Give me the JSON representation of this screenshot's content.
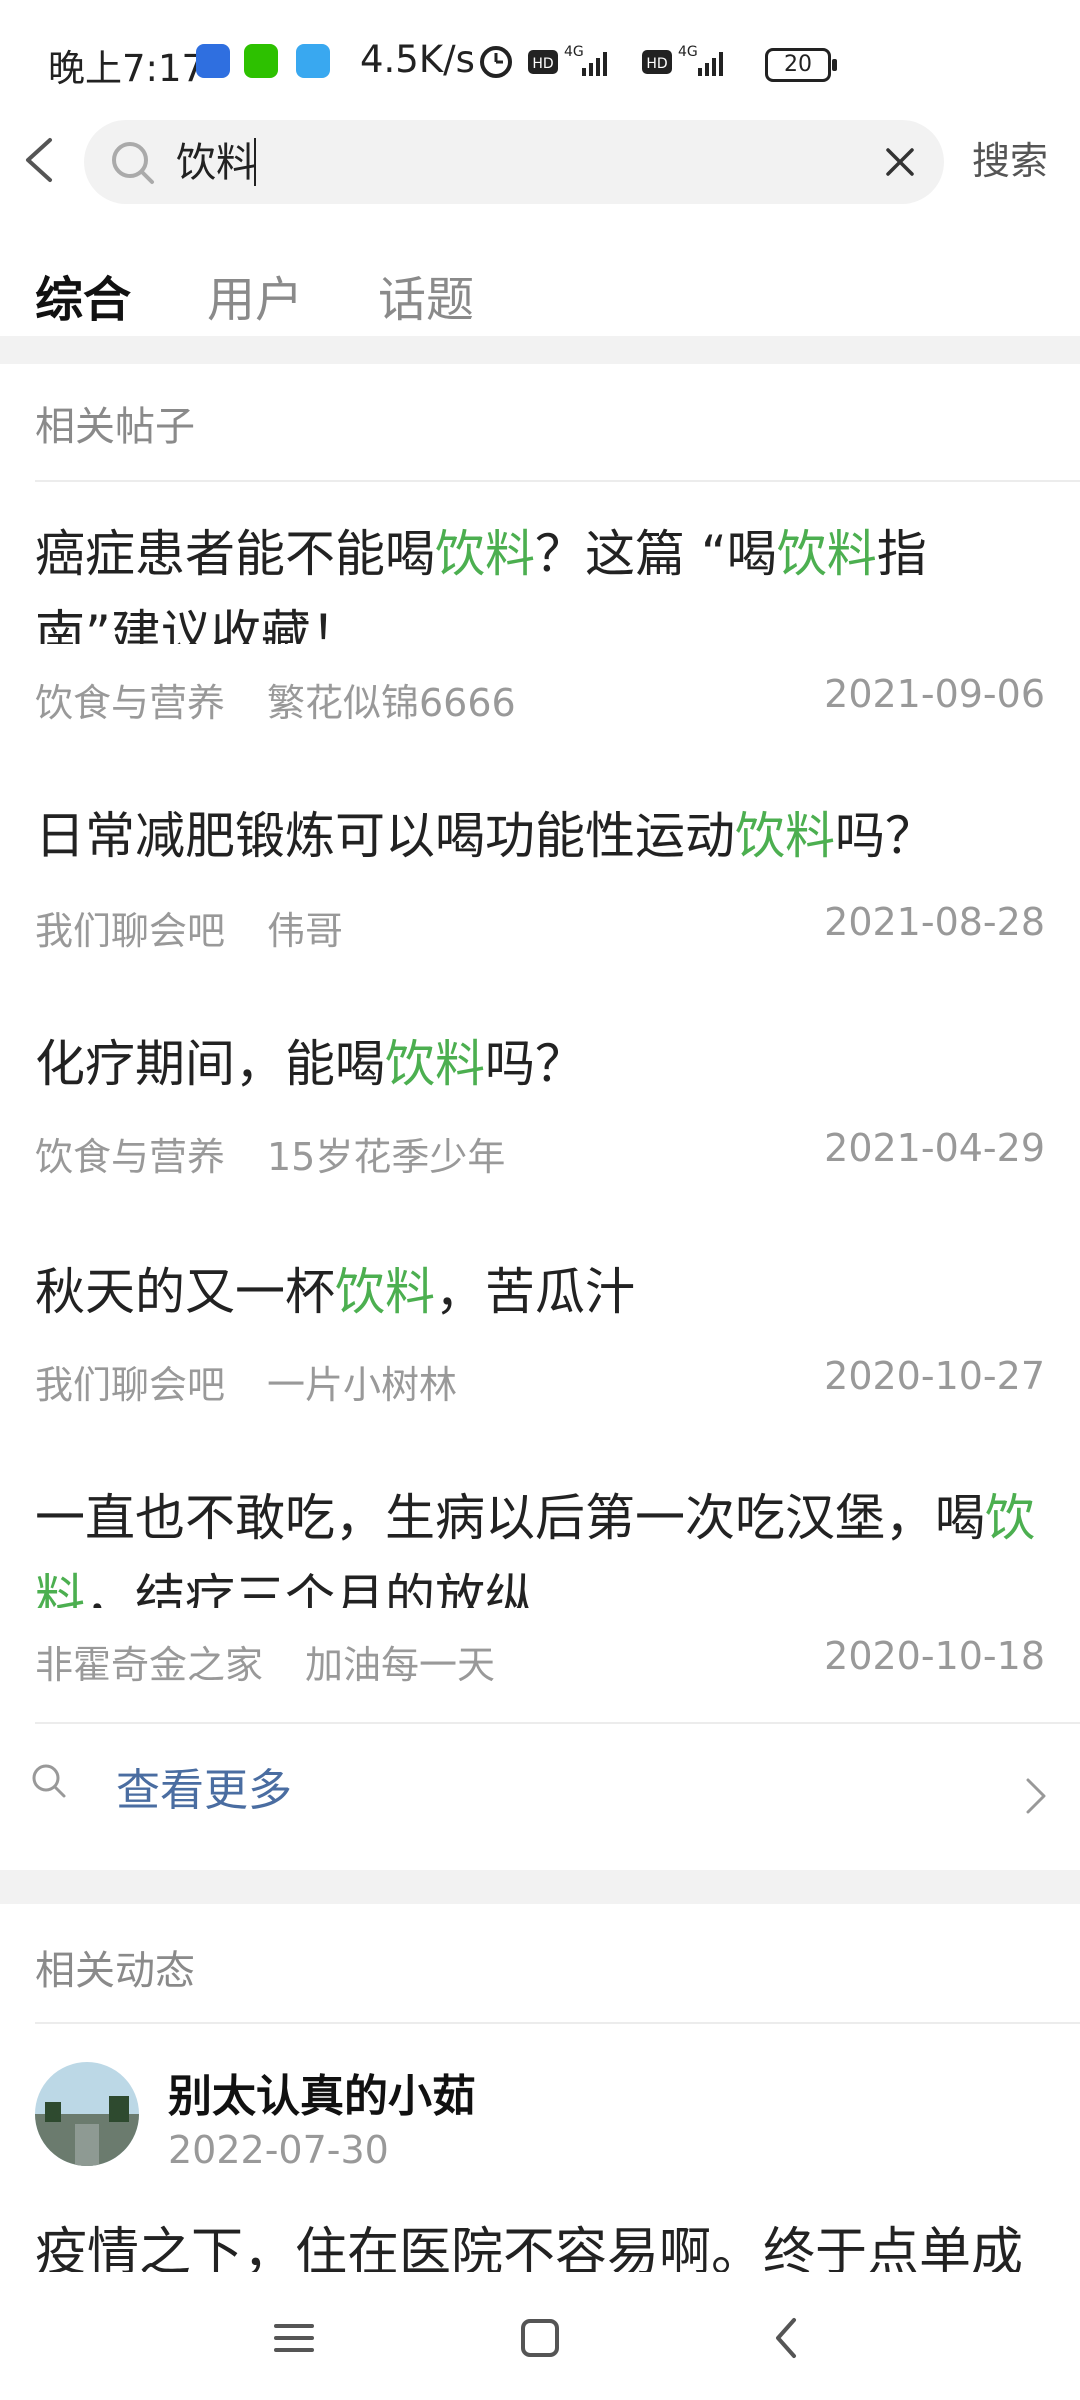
{
  "status": {
    "time": "晚上7:17",
    "net_speed": "4.5K/s",
    "battery": "20",
    "signal_1_label": "4G",
    "signal_2_label": "4G",
    "hd_1": "HD",
    "hd_2": "HD"
  },
  "search": {
    "query": "饮料",
    "submit_label": "搜索"
  },
  "tabs": [
    {
      "label": "综合",
      "active": true
    },
    {
      "label": "用户",
      "active": false
    },
    {
      "label": "话题",
      "active": false
    }
  ],
  "related_posts": {
    "section_title": "相关帖子",
    "posts": [
      {
        "title_parts": [
          "癌症患者能不能喝",
          "饮料",
          "？这篇 “喝",
          "饮料",
          "指南”建议收藏！"
        ],
        "forum": "饮食与营养",
        "author": "繁花似锦6666",
        "date": "2021-09-06"
      },
      {
        "title_parts": [
          "日常减肥锻炼可以喝功能性运动",
          "饮料",
          "吗？"
        ],
        "forum": "我们聊会吧",
        "author": "伟哥",
        "date": "2021-08-28"
      },
      {
        "title_parts": [
          "化疗期间，能喝",
          "饮料",
          "吗？"
        ],
        "forum": "饮食与营养",
        "author": "15岁花季少年",
        "date": "2021-04-29"
      },
      {
        "title_parts": [
          "秋天的又一杯",
          "饮料",
          "，苦瓜汁"
        ],
        "forum": "我们聊会吧",
        "author": "一片小树林",
        "date": "2020-10-27"
      },
      {
        "title_parts": [
          "一直也不敢吃，生病以后第一次吃汉堡，喝",
          "饮料",
          "，结疗三个月的放纵"
        ],
        "forum": "非霍奇金之家",
        "author": "加油每一天",
        "date": "2020-10-18"
      }
    ],
    "more_label": "查看更多"
  },
  "related_dynamics": {
    "section_title": "相关动态",
    "user_name": "别太认真的小茹",
    "date": "2022-07-30",
    "text": "疫情之下，住在医院不容易啊。终于点单成"
  },
  "colors": {
    "highlight": "#4caf50",
    "link": "#4a6da1",
    "muted": "#999999"
  }
}
